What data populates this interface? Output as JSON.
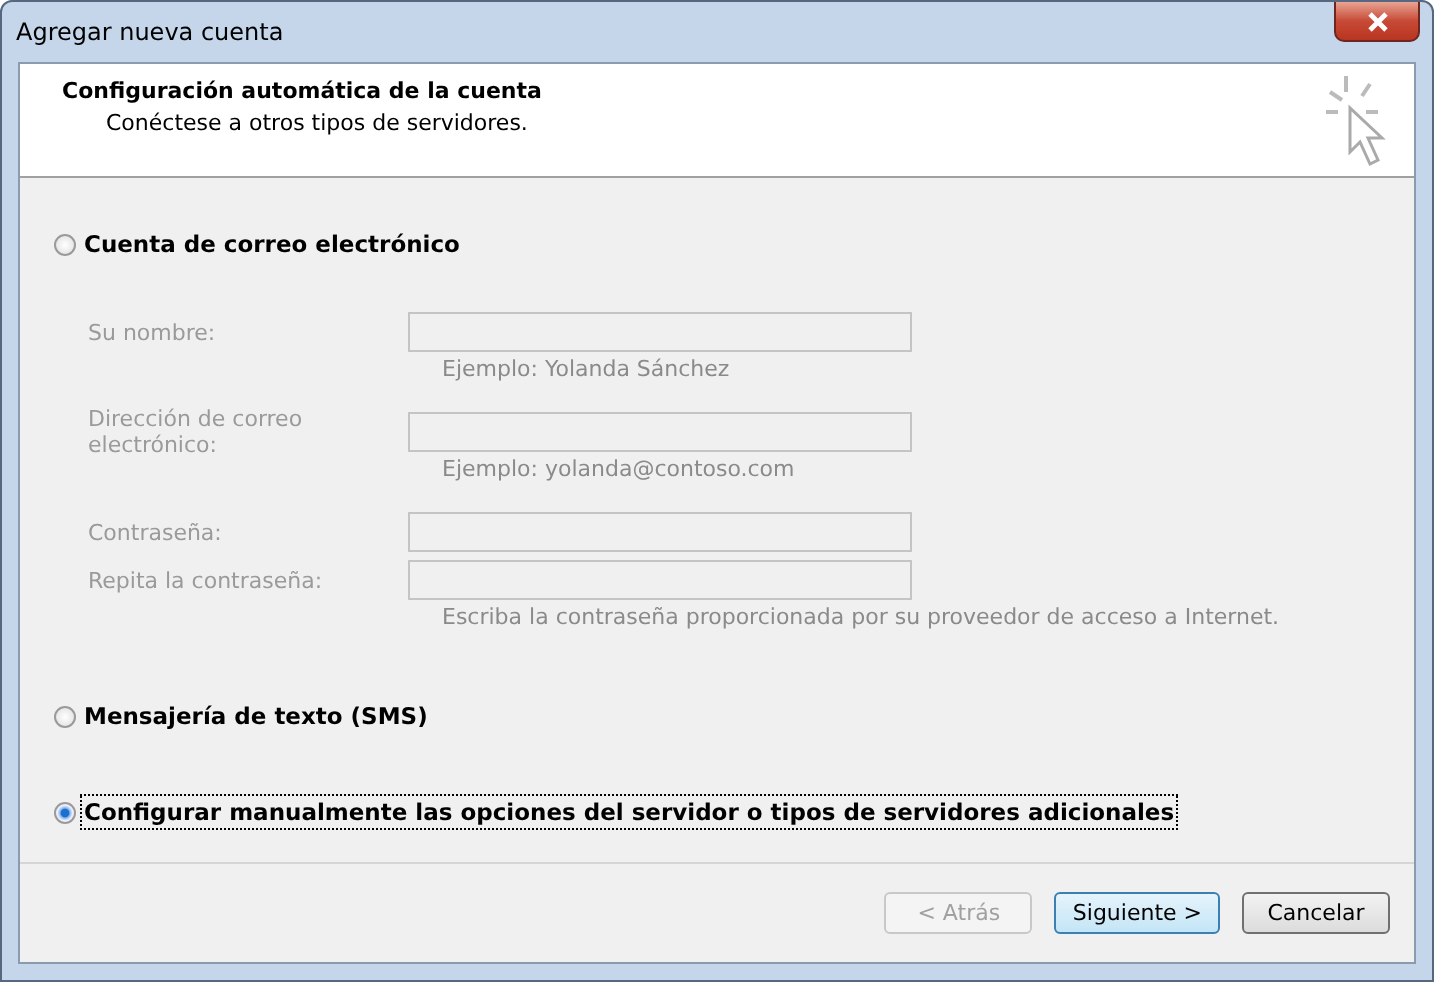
{
  "window": {
    "title": "Agregar nueva cuenta"
  },
  "header": {
    "title": "Configuración automática de la cuenta",
    "subtitle": "Conéctese a otros tipos de servidores."
  },
  "options": [
    {
      "label": "Cuenta de correo electrónico",
      "selected": false,
      "focused": false,
      "fields": [
        {
          "label": "Su nombre:",
          "disabled": true,
          "hint": "Ejemplo: Yolanda Sánchez"
        },
        {
          "label": "Dirección de correo electrónico:",
          "disabled": true,
          "hint": "Ejemplo: yolanda@contoso.com"
        },
        {
          "label": "Contraseña:",
          "disabled": true
        },
        {
          "label": "Repita la contraseña:",
          "disabled": true,
          "hint": "Escriba la contraseña proporcionada por su proveedor de acceso a Internet."
        }
      ]
    },
    {
      "label": "Mensajería de texto (SMS)",
      "selected": false,
      "focused": false
    },
    {
      "label": "Configurar manualmente las opciones del servidor o tipos de servidores adicionales",
      "selected": true,
      "focused": true
    }
  ],
  "buttons": [
    {
      "label": "< Atrás",
      "disabled": true,
      "default": false
    },
    {
      "label": "Siguiente >",
      "disabled": false,
      "default": true
    },
    {
      "label": "Cancelar",
      "disabled": false,
      "default": false
    }
  ]
}
